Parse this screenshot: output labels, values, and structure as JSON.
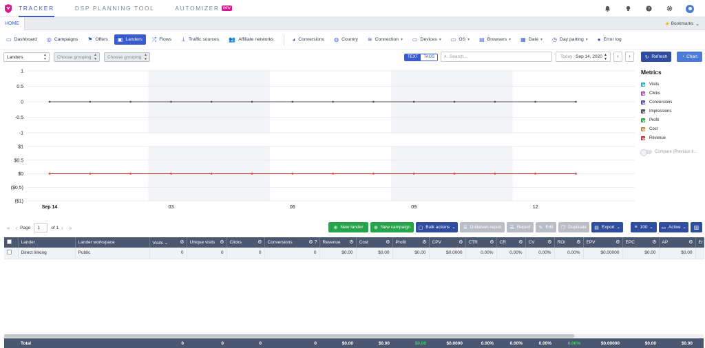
{
  "topbar": {
    "nav": [
      {
        "label": "TRACKER",
        "active": true
      },
      {
        "label": "DSP PLANNING TOOL",
        "active": false
      },
      {
        "label": "AUTOMIZER",
        "active": false,
        "badge": "new"
      }
    ],
    "icons": [
      "bell-icon",
      "lightbulb-icon",
      "help-icon",
      "gear-icon",
      "user-avatar-icon"
    ]
  },
  "tabbar": {
    "home": "HOME",
    "bookmarks": "Bookmarks"
  },
  "navbar": {
    "items": [
      {
        "label": "Dashboard",
        "icon": "monitor-icon"
      },
      {
        "label": "Campaigns",
        "icon": "target-icon"
      },
      {
        "label": "Offers",
        "icon": "flag-icon"
      },
      {
        "label": "Landers",
        "icon": "lander-icon",
        "active": true
      },
      {
        "label": "Flows",
        "icon": "shuffle-icon"
      },
      {
        "label": "Traffic sources",
        "icon": "traffic-icon"
      },
      {
        "label": "Affiliate networks",
        "icon": "users-icon"
      }
    ],
    "items2": [
      {
        "label": "Conversions",
        "icon": "pie-icon"
      },
      {
        "label": "Country",
        "icon": "globe-icon"
      },
      {
        "label": "Connection",
        "icon": "wifi-icon",
        "caret": true
      },
      {
        "label": "Devices",
        "icon": "laptop-icon",
        "caret": true
      },
      {
        "label": "OS",
        "icon": "desktop-icon",
        "caret": true
      },
      {
        "label": "Browsers",
        "icon": "browser-icon",
        "caret": true
      },
      {
        "label": "Date",
        "icon": "calendar-icon",
        "caret": true
      },
      {
        "label": "Day parting",
        "icon": "clock-icon",
        "caret": true
      },
      {
        "label": "Error log",
        "icon": "error-icon"
      }
    ]
  },
  "filters": {
    "group1": "Landers",
    "group2": "Choose grouping",
    "group3": "Choose grouping",
    "text_toggle": "TEXT",
    "tags_toggle": "TAGS",
    "search_placeholder": "Search...",
    "date_label": "Today:",
    "date_value": "Sep 14, 2020",
    "refresh": "Refresh",
    "chart": "Chart"
  },
  "chart_data": {
    "type": "line",
    "x": [
      "Sep 14",
      "",
      "",
      "03",
      "",
      "",
      "06",
      "",
      "",
      "09",
      "",
      "",
      "12",
      "",
      ""
    ],
    "x_tick_labels": [
      "Sep 14",
      "03",
      "06",
      "09",
      "12"
    ],
    "top_panel": {
      "y_ticks": [
        "1",
        "0.5",
        "0",
        "-0.5",
        "-1"
      ],
      "ylim": [
        -1,
        1
      ],
      "series": [
        {
          "values": [
            0,
            0,
            0,
            0,
            0,
            0,
            0,
            0,
            0,
            0,
            0,
            0,
            0,
            0
          ],
          "color": "#555555"
        }
      ]
    },
    "bottom_panel": {
      "y_ticks": [
        "$1",
        "$0.5",
        "$0",
        "($0.5)",
        "($1)"
      ],
      "ylim": [
        -1,
        1
      ],
      "series": [
        {
          "values": [
            0,
            0,
            0,
            0,
            0,
            0,
            0,
            0,
            0,
            0,
            0,
            0,
            0,
            0
          ],
          "color": "#d9453c"
        }
      ]
    }
  },
  "metrics": {
    "title": "Metrics",
    "items": [
      {
        "label": "Visits",
        "color": "#3fc6e6"
      },
      {
        "label": "Clicks",
        "color": "#c768c9"
      },
      {
        "label": "Conversions",
        "color": "#6f5fc2"
      },
      {
        "label": "Impressions",
        "color": "#555c66"
      },
      {
        "label": "Profit",
        "color": "#3ebf54"
      },
      {
        "label": "Cost",
        "color": "#f0a35a"
      },
      {
        "label": "Revenue",
        "color": "#e0534f"
      }
    ],
    "compare": "Compare (Previous ti..."
  },
  "pager": {
    "page_label": "Page",
    "page": "1",
    "of": "of 1"
  },
  "actions": {
    "new_lander": "New lander",
    "new_campaign": "New campaign",
    "bulk": "Bulk actions",
    "drilldown": "Drilldown report",
    "report": "Report",
    "edit": "Edit",
    "duplicate": "Duplicate",
    "export": "Export",
    "rows": "100",
    "status": "Active"
  },
  "table": {
    "columns": [
      "Lander",
      "Lander workspace",
      "Visits",
      "Unique visits",
      "Clicks",
      "Conversions",
      "Revenue",
      "Cost",
      "Profit",
      "CPV",
      "CTR",
      "CR",
      "CV",
      "ROI",
      "EPV",
      "EPC",
      "AP",
      "Er"
    ],
    "rows": [
      [
        "Direct linking",
        "Public",
        "0",
        "0",
        "0",
        "0",
        "$0.00",
        "$0.00",
        "$0.00",
        "$0.0000",
        "0.00%",
        "0.00%",
        "0.00%",
        "0.00%",
        "$0.00000",
        "$0.00",
        "$0.00",
        ""
      ]
    ],
    "total": [
      "Total",
      "",
      "0",
      "0",
      "0",
      "0",
      "$0.00",
      "$0.00",
      "$0.00",
      "$0.0000",
      "0.00%",
      "0.00%",
      "0.00%",
      "0.00%",
      "$0.00000",
      "$0.00",
      "$0.00",
      ""
    ]
  }
}
